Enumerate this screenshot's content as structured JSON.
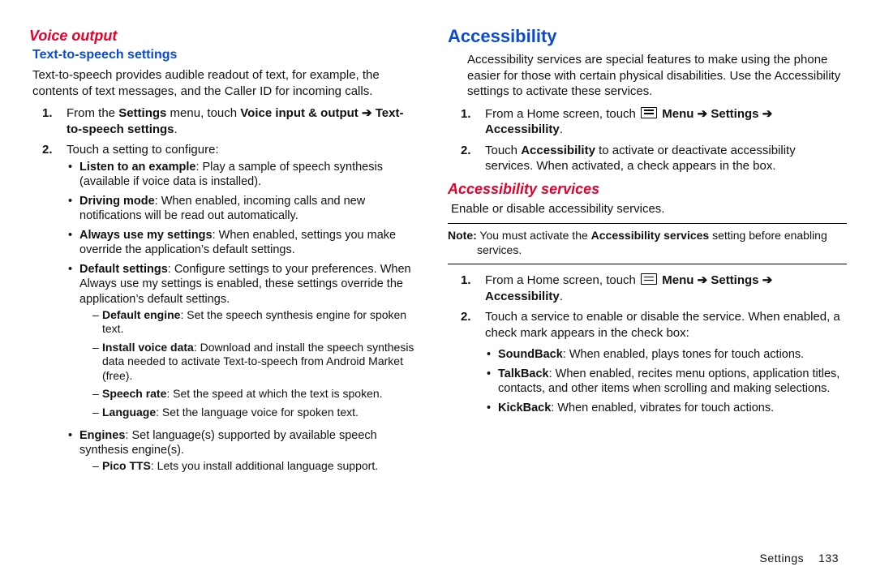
{
  "left": {
    "h_voice_output": "Voice output",
    "h_tts": "Text-to-speech settings",
    "p_tts_intro": "Text-to-speech provides audible readout of text, for example, the contents of text messages, and the Caller ID for incoming calls.",
    "step1_a": "From the ",
    "step1_settings": "Settings",
    "step1_b": " menu, touch ",
    "step1_voice": "Voice input & output",
    "step1_tts": "Text-to-speech settings",
    "step2": "Touch a setting to configure:",
    "b1_t": "Listen to an example",
    "b1_d": ": Play a sample of speech synthesis (available if voice data is installed).",
    "b2_t": "Driving mode",
    "b2_d": ": When enabled, incoming calls and new notifications will be read out automatically.",
    "b3_t": "Always use my settings",
    "b3_d": ": When enabled, settings you make override the application’s default settings.",
    "b4_t": "Default settings",
    "b4_d": ": Configure settings to your preferences. When Always use my settings is enabled, these settings override the application’s default settings.",
    "d1_t": "Default engine",
    "d1_d": ": Set the speech synthesis engine for spoken text.",
    "d2_t": "Install voice data",
    "d2_d": ": Download and install the speech synthesis data needed to activate Text-to-speech from Android Market (free).",
    "d3_t": "Speech rate",
    "d3_d": ": Set the speed at which the text is spoken.",
    "d4_t": "Language",
    "d4_d": ": Set the language voice for spoken text.",
    "b5_t": "Engines",
    "b5_d": ": Set language(s) supported by available speech synthesis engine(s).",
    "d5_t": "Pico TTS",
    "d5_d": ": Lets you install additional language support."
  },
  "right": {
    "h_access": "Accessibility",
    "p_access_intro": "Accessibility services are special features to make using the phone easier for those with certain physical disabilities. Use the Accessibility settings to activate these services.",
    "step1_a": "From a Home screen, touch ",
    "step1_menu": "Menu",
    "step1_settings": "Settings",
    "step1_access": "Accessibility",
    "step2_a": "Touch ",
    "step2_b": "Accessibility",
    "step2_c": " to activate or deactivate accessibility services. When activated, a check appears in the box.",
    "h_services": "Accessibility services",
    "p_services_intro": "Enable or disable accessibility services.",
    "note_lead": "Note:",
    "note_a": " You must activate the ",
    "note_b": "Accessibility services",
    "note_c": " setting before enabling",
    "note_d": "services.",
    "svc_step2": "Touch a service to enable or disable the service. When enabled, a check mark appears in the check box:",
    "s1_t": "SoundBack",
    "s1_d": ": When enabled, plays tones for touch actions.",
    "s2_t": "TalkBack",
    "s2_d": ": When enabled, recites menu options, application titles, contacts, and other items when scrolling and making selections.",
    "s3_t": "KickBack",
    "s3_d": ": When enabled, vibrates for touch actions."
  },
  "footer": {
    "section": "Settings",
    "page": "133"
  },
  "glyphs": {
    "arrow": "➔",
    "bullet": "•",
    "dash": "–"
  }
}
